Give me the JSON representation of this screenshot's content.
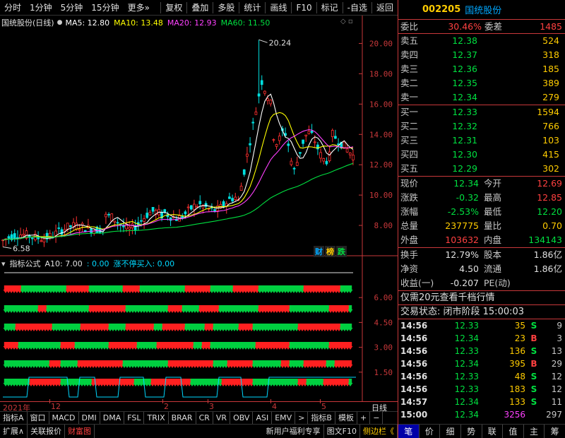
{
  "toolbar": {
    "left": [
      "分时",
      "1分钟",
      "5分钟",
      "15分钟",
      "更多"
    ],
    "right": [
      "复权",
      "叠加",
      "多股",
      "统计",
      "画线",
      "F10",
      "标记",
      "-自选",
      "返回"
    ]
  },
  "chart": {
    "stock_title": "国统股份(日线)",
    "ma": [
      {
        "label": "MA5: 12.80",
        "color": "#ffffff"
      },
      {
        "label": "MA10: 13.48",
        "color": "#ffff00"
      },
      {
        "label": "MA20: 12.93",
        "color": "#ff40ff"
      },
      {
        "label": "MA60: 11.50",
        "color": "#00e040"
      }
    ],
    "high_label": "20.24",
    "low_label": "6.58",
    "badges": [
      {
        "text": "财",
        "color": "#00a8ff"
      },
      {
        "text": "榜",
        "color": "#ffcc00"
      },
      {
        "text": "跌",
        "color": "#00e040"
      }
    ]
  },
  "chart_data": {
    "type": "candlestick",
    "yticks": [
      8.0,
      10.0,
      12.0,
      14.0,
      16.0,
      18.0,
      20.0
    ],
    "ylim": [
      6.0,
      21.0
    ],
    "high": 20.24,
    "low": 6.58,
    "indicator_yticks": [
      1.5,
      3.0,
      4.5,
      6.0
    ],
    "indicator_ylim": [
      0,
      7.5
    ]
  },
  "indicator": {
    "name": "指标公式",
    "a10": "A10: 7.00",
    "v1": ": 0.00",
    "v2": "涨不停买入: 0.00"
  },
  "timeaxis": {
    "labels": [
      "2021年",
      "12",
      "2",
      "3",
      "4",
      "5"
    ],
    "right": "日线"
  },
  "tabs1": [
    "指标A",
    "窗口",
    "MACD",
    "DMI",
    "DMA",
    "FSL",
    "TRIX",
    "BRAR",
    "CR",
    "VR",
    "OBV",
    "ASI",
    "EMV",
    ">",
    "指标B",
    "模板",
    "+",
    "−"
  ],
  "tabs2": {
    "left": [
      "扩展∧",
      "关联报价",
      "财富图"
    ],
    "right": [
      "新用户福利专享",
      "图文F10",
      "侧边栏《"
    ]
  },
  "quote": {
    "code": "002205",
    "name": "国统股份",
    "weibi_label": "委比",
    "weibi": "30.46%",
    "weicha_label": "委差",
    "weicha": "1485",
    "sell": [
      {
        "label": "卖五",
        "price": "12.38",
        "vol": "524"
      },
      {
        "label": "卖四",
        "price": "12.37",
        "vol": "318"
      },
      {
        "label": "卖三",
        "price": "12.36",
        "vol": "185"
      },
      {
        "label": "卖二",
        "price": "12.35",
        "vol": "389"
      },
      {
        "label": "卖一",
        "price": "12.34",
        "vol": "279"
      }
    ],
    "buy": [
      {
        "label": "买一",
        "price": "12.33",
        "vol": "1594"
      },
      {
        "label": "买二",
        "price": "12.32",
        "vol": "766"
      },
      {
        "label": "买三",
        "price": "12.31",
        "vol": "103"
      },
      {
        "label": "买四",
        "price": "12.30",
        "vol": "415"
      },
      {
        "label": "买五",
        "price": "12.29",
        "vol": "302"
      }
    ],
    "stats": [
      [
        {
          "l": "现价",
          "v": "12.34",
          "c": "g"
        },
        {
          "l": "今开",
          "v": "12.69",
          "c": "r"
        }
      ],
      [
        {
          "l": "涨跌",
          "v": "-0.32",
          "c": "g"
        },
        {
          "l": "最高",
          "v": "12.85",
          "c": "r"
        }
      ],
      [
        {
          "l": "涨幅",
          "v": "-2.53%",
          "c": "g"
        },
        {
          "l": "最低",
          "v": "12.20",
          "c": "g"
        }
      ],
      [
        {
          "l": "总量",
          "v": "237775",
          "c": "y"
        },
        {
          "l": "量比",
          "v": "0.70",
          "c": "y"
        }
      ],
      [
        {
          "l": "外盘",
          "v": "103632",
          "c": "r"
        },
        {
          "l": "内盘",
          "v": "134143",
          "c": "g"
        }
      ]
    ],
    "stats2": [
      [
        {
          "l": "换手",
          "v": "12.79%",
          "c": "w"
        },
        {
          "l": "股本",
          "v": "1.86亿",
          "c": "w"
        }
      ],
      [
        {
          "l": "净资",
          "v": "4.50",
          "c": "w"
        },
        {
          "l": "流通",
          "v": "1.86亿",
          "c": "w"
        }
      ],
      [
        {
          "l": "收益(一)",
          "v": "-0.207",
          "c": "w"
        },
        {
          "l": "PE(动)",
          "v": "",
          "c": "w"
        }
      ]
    ],
    "promo": "仅需20元查看千档行情",
    "status": "交易状态: 闭市阶段 15:00:03",
    "ticks": [
      {
        "t": "14:56",
        "p": "12.33",
        "v": "35",
        "d": "S",
        "n": "9"
      },
      {
        "t": "14:56",
        "p": "12.34",
        "v": "23",
        "d": "B",
        "n": "3"
      },
      {
        "t": "14:56",
        "p": "12.33",
        "v": "136",
        "d": "S",
        "n": "13"
      },
      {
        "t": "14:56",
        "p": "12.34",
        "v": "395",
        "d": "B",
        "n": "29"
      },
      {
        "t": "14:56",
        "p": "12.33",
        "v": "48",
        "d": "S",
        "n": "12"
      },
      {
        "t": "14:56",
        "p": "12.33",
        "v": "183",
        "d": "S",
        "n": "12"
      },
      {
        "t": "14:57",
        "p": "12.34",
        "v": "133",
        "d": "S",
        "n": "11"
      },
      {
        "t": "15:00",
        "p": "12.34",
        "v": "3256",
        "d": "",
        "n": "297"
      }
    ],
    "tabs": [
      "笔",
      "价",
      "细",
      "势",
      "联",
      "值",
      "主",
      "筹"
    ]
  }
}
